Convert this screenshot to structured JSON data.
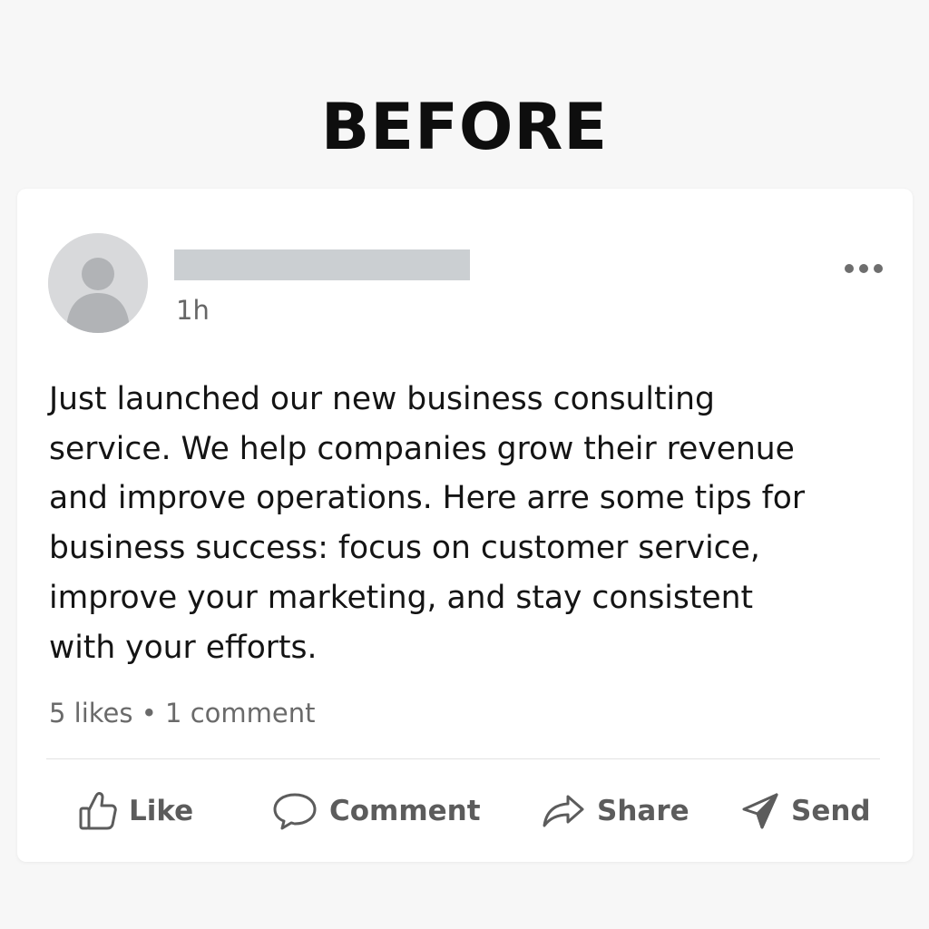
{
  "heading": "BEFORE",
  "post": {
    "timestamp": "1h",
    "body": "Just launched our new business consulting service. We help companies grow their revenue and improve operations. Here arre some tips for business success: focus on customer service, improve your marketing, and stay consistent with your efforts.",
    "stats": "5 likes • 1 comment"
  },
  "actions": {
    "like": {
      "label": "Like",
      "icon": "thumbs-up-icon"
    },
    "comment": {
      "label": "Comment",
      "icon": "speech-bubble-icon"
    },
    "share": {
      "label": "Share",
      "icon": "share-arrow-icon"
    },
    "send": {
      "label": "Send",
      "icon": "paper-plane-icon"
    }
  },
  "colors": {
    "background": "#f7f7f7",
    "card": "#ffffff",
    "placeholder": "#cbcfd2",
    "avatar": "#d8d9db",
    "action_text": "#5c5c5c"
  }
}
